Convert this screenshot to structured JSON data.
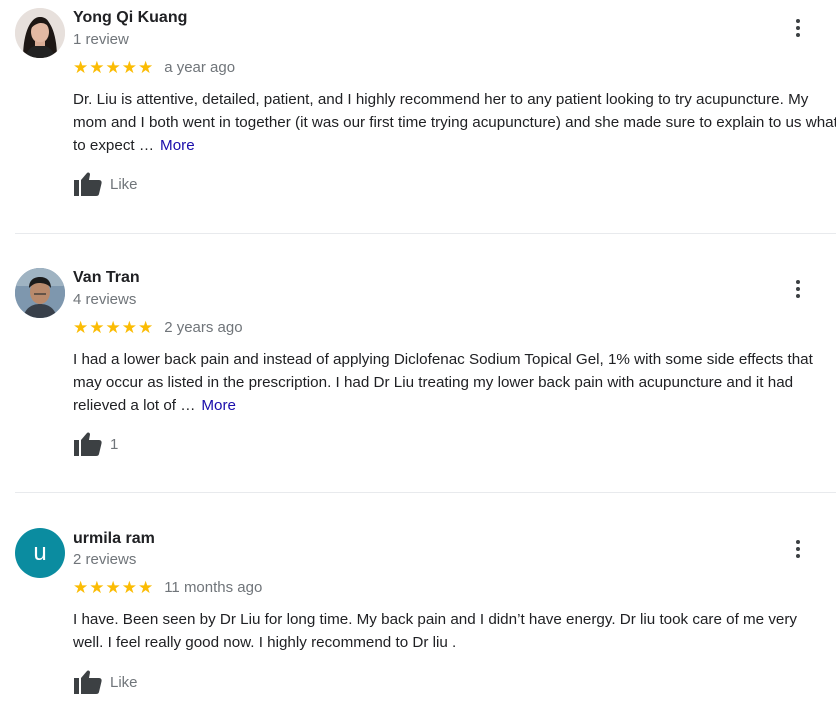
{
  "reviews": [
    {
      "name": "Yong Qi Kuang",
      "count": "1 review",
      "stars": "★★★★★",
      "time": "a year ago",
      "text": "Dr. Liu is attentive, detailed, patient, and I highly recommend her to any patient looking to try acupuncture. My mom and I both went in together (it was our first time trying acupuncture) and she made sure to explain to us what to expect …",
      "more": "More",
      "like": "Like",
      "avatar_icon": "user-photo"
    },
    {
      "name": "Van Tran",
      "count": "4 reviews",
      "stars": "★★★★★",
      "time": "2 years ago",
      "text": "I had a lower back pain and instead of applying Diclofenac Sodium Topical Gel, 1% with some side effects that may occur as listed in the prescription. I had Dr Liu treating my lower back pain with acupuncture and it had relieved a lot of …",
      "more": "More",
      "like": "1",
      "avatar_icon": "user-photo"
    },
    {
      "name": "urmila ram",
      "count": "2 reviews",
      "stars": "★★★★★",
      "time": "11 months ago",
      "text": "I  have. Been seen by Dr Liu for long time. My back pain and I didn’t have energy. Dr liu took care of me very well. I feel really good now. I highly recommend to Dr liu .",
      "like": "Like",
      "avatar_letter": "u",
      "avatar_color": "#0b8ca0"
    }
  ],
  "colors": {
    "star": "#fbbc04",
    "link": "#1a0dab",
    "secondary_text": "#70757a",
    "divider": "#e8eaed"
  },
  "icons": {
    "like": "thumbs-up-icon",
    "menu": "more-vert-icon"
  }
}
